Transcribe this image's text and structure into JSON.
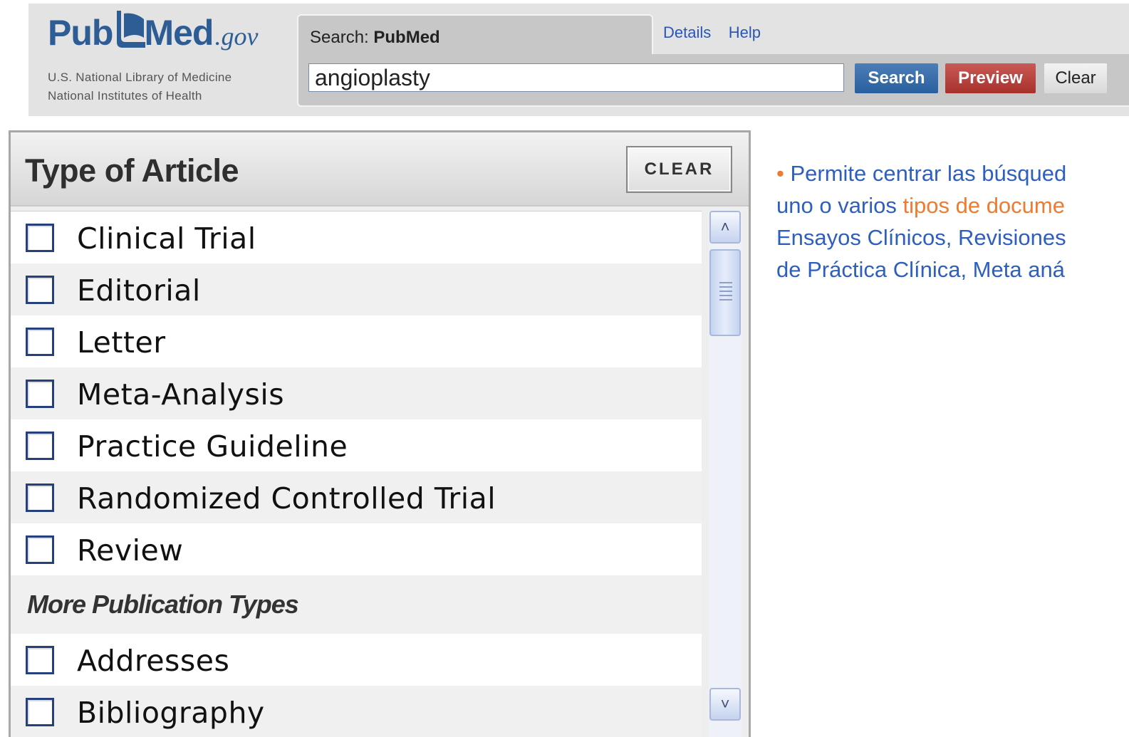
{
  "logo": {
    "pub": "Pub",
    "med": "Med",
    "gov": ".gov",
    "line1": "U.S. National Library of Medicine",
    "line2": "National Institutes of Health"
  },
  "search": {
    "label_prefix": "Search: ",
    "database": "PubMed",
    "query": "angioplasty",
    "search_button": "Search",
    "preview_button": "Preview",
    "clear_button": "Clear",
    "links": [
      "Details",
      "Help"
    ]
  },
  "filter": {
    "title": "Type of Article",
    "clear_button": "CLEAR",
    "items": [
      {
        "label": "Clinical Trial",
        "checked": false
      },
      {
        "label": "Editorial",
        "checked": false
      },
      {
        "label": "Letter",
        "checked": false
      },
      {
        "label": "Meta-Analysis",
        "checked": false
      },
      {
        "label": "Practice Guideline",
        "checked": false
      },
      {
        "label": "Randomized Controlled Trial",
        "checked": false
      },
      {
        "label": "Review",
        "checked": false
      }
    ],
    "more_heading": "More Publication Types",
    "more_items": [
      {
        "label": "Addresses",
        "checked": false
      },
      {
        "label": "Bibliography",
        "checked": false
      }
    ]
  },
  "note": {
    "bullet": "•",
    "line1": "Permite centrar las búsqued",
    "line2_a": "uno o varios ",
    "line2_b": "tipos de docume",
    "line3": "Ensayos Clínicos, Revisiones",
    "line4": "de Práctica Clínica, Meta aná"
  },
  "colors": {
    "brand_blue": "#2e5c95",
    "note_blue": "#2e5fbf",
    "note_orange": "#f07a30",
    "search_button": "#285f9e",
    "preview_button": "#a8312c"
  }
}
